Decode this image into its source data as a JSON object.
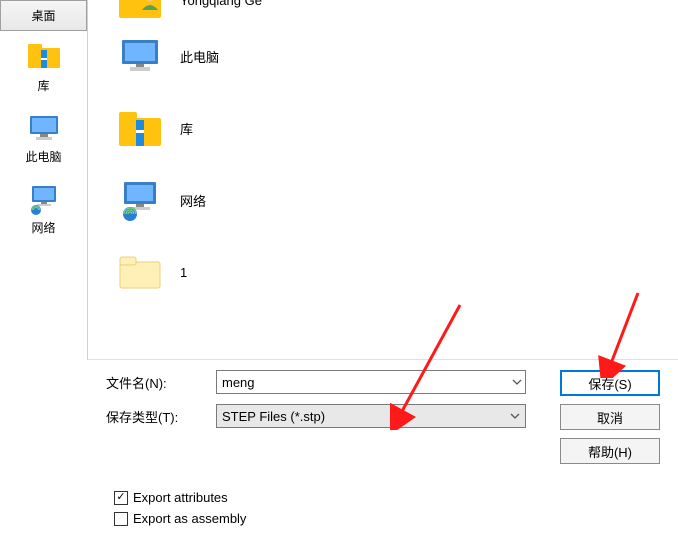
{
  "sidebar": {
    "tab_label": "桌面",
    "items": [
      {
        "label": "库"
      },
      {
        "label": "此电脑"
      },
      {
        "label": "网络"
      }
    ]
  },
  "main": {
    "items": [
      {
        "label": "Yongqiang Ge",
        "icon": "user-folder"
      },
      {
        "label": "此电脑",
        "icon": "computer"
      },
      {
        "label": "库",
        "icon": "libraries"
      },
      {
        "label": "网络",
        "icon": "network"
      },
      {
        "label": "1",
        "icon": "folder"
      }
    ]
  },
  "form": {
    "filename_label": "文件名(N):",
    "filename_value": "meng",
    "filetype_label": "保存类型(T):",
    "filetype_value": "STEP Files (*.stp)"
  },
  "buttons": {
    "save": "保存(S)",
    "cancel": "取消",
    "help": "帮助(H)"
  },
  "checks": {
    "export_attributes": "Export attributes",
    "export_assembly": "Export as assembly",
    "attributes_checked": true,
    "assembly_checked": false
  }
}
